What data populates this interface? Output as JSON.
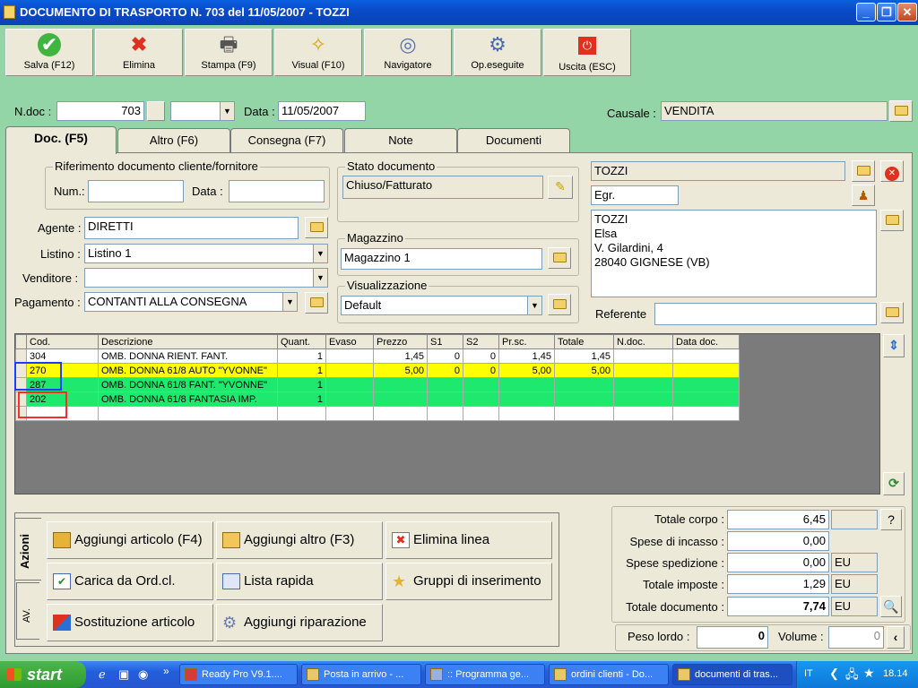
{
  "window": {
    "title": "DOCUMENTO DI TRASPORTO N. 703  del 11/05/2007 - TOZZI"
  },
  "toolbar": [
    {
      "label": "Salva (F12)",
      "icon": "check-icon"
    },
    {
      "label": "Elimina",
      "icon": "x-icon"
    },
    {
      "label": "Stampa (F9)",
      "icon": "printer-icon"
    },
    {
      "label": "Visual (F10)",
      "icon": "magic-wand-icon"
    },
    {
      "label": "Navigatore",
      "icon": "compass-icon"
    },
    {
      "label": "Op.eseguite",
      "icon": "gear-search-icon"
    },
    {
      "label": "Uscita (ESC)",
      "icon": "exit-icon"
    }
  ],
  "header": {
    "ndoc_label": "N.doc :",
    "ndoc_value": "703",
    "data_label": "Data :",
    "data_value": "11/05/2007",
    "causale_label": "Causale :",
    "causale_value": "VENDITA"
  },
  "tabs": [
    "Doc. (F5)",
    "Altro (F6)",
    "Consegna (F7)",
    "Note",
    "Documenti"
  ],
  "rif": {
    "title": "Riferimento documento cliente/fornitore",
    "num_label": "Num.:",
    "data_label": "Data :"
  },
  "fields": {
    "agente_label": "Agente :",
    "agente_value": "DIRETTI",
    "listino_label": "Listino :",
    "listino_value": "Listino 1",
    "venditore_label": "Venditore :",
    "venditore_value": "",
    "pagamento_label": "Pagamento :",
    "pagamento_value": "CONTANTI ALLA CONSEGNA"
  },
  "stato": {
    "title": "Stato documento",
    "value": "Chiuso/Fatturato"
  },
  "magazzino": {
    "title": "Magazzino",
    "value": "Magazzino 1"
  },
  "visualizzazione": {
    "title": "Visualizzazione",
    "value": "Default"
  },
  "cliente": {
    "name": "TOZZI",
    "title": "Egr.",
    "address": [
      "TOZZI",
      "Elsa",
      "V. Gilardini, 4",
      "28040 GIGNESE (VB)"
    ],
    "referente_label": "Referente"
  },
  "grid": {
    "columns": [
      "Cod.",
      "Descrizione",
      "Quant.",
      "Evaso",
      "Prezzo",
      "S1",
      "S2",
      "Pr.sc.",
      "Totale",
      "N.doc.",
      "Data doc."
    ],
    "rows": [
      {
        "cod": "304",
        "desc": "OMB. DONNA RIENT. FANT.",
        "quant": "1",
        "evaso": "",
        "prezzo": "1,45",
        "s1": "0",
        "s2": "0",
        "prsc": "1,45",
        "totale": "1,45",
        "ndoc": "",
        "datadoc": "",
        "style": "white"
      },
      {
        "cod": "270",
        "desc": "OMB. DONNA 61/8 AUTO \"YVONNE\"",
        "quant": "1",
        "evaso": "",
        "prezzo": "5,00",
        "s1": "0",
        "s2": "0",
        "prsc": "5,00",
        "totale": "5,00",
        "ndoc": "",
        "datadoc": "",
        "style": "yellow"
      },
      {
        "cod": "287",
        "desc": "OMB. DONNA 61/8 FANT. \"YVONNE\"",
        "quant": "1",
        "evaso": "",
        "prezzo": "",
        "s1": "",
        "s2": "",
        "prsc": "",
        "totale": "",
        "ndoc": "",
        "datadoc": "",
        "style": "green"
      },
      {
        "cod": "202",
        "desc": "OMB. DONNA 61/8 FANTASIA IMP.",
        "quant": "1",
        "evaso": "",
        "prezzo": "",
        "s1": "",
        "s2": "",
        "prsc": "",
        "totale": "",
        "ndoc": "",
        "datadoc": "",
        "style": "green"
      },
      {
        "cod": "",
        "desc": "",
        "quant": "",
        "evaso": "",
        "prezzo": "",
        "s1": "",
        "s2": "",
        "prsc": "",
        "totale": "",
        "ndoc": "",
        "datadoc": "",
        "style": "white"
      }
    ]
  },
  "actions": {
    "side_tabs": [
      "Azioni",
      "AV."
    ],
    "buttons": [
      "Aggiungi articolo (F4)",
      "Aggiungi altro (F3)",
      "Elimina linea",
      "Carica da Ord.cl.",
      "Lista rapida",
      "Gruppi di inserimento",
      "Sostituzione articolo",
      "Aggiungi riparazione"
    ]
  },
  "totals": {
    "corpo_label": "Totale corpo :",
    "corpo_value": "6,45",
    "incasso_label": "Spese di incasso :",
    "incasso_value": "0,00",
    "spedizione_label": "Spese spedizione :",
    "spedizione_value": "0,00",
    "spedizione_cur": "EU",
    "imposte_label": "Totale imposte :",
    "imposte_value": "1,29",
    "imposte_cur": "EU",
    "documento_label": "Totale documento :",
    "documento_value": "7,74",
    "documento_cur": "EU",
    "peso_label": "Peso lordo :",
    "peso_value": "0",
    "volume_label": "Volume :",
    "volume_value": "0",
    "help_label": "?"
  },
  "taskbar": {
    "start": "start",
    "tasks": [
      "Ready Pro V9.1....",
      "Posta in arrivo - ...",
      ":: Programma ge...",
      "ordini clienti - Do...",
      "documenti di tras..."
    ],
    "lang": "IT",
    "clock": "18.14"
  }
}
